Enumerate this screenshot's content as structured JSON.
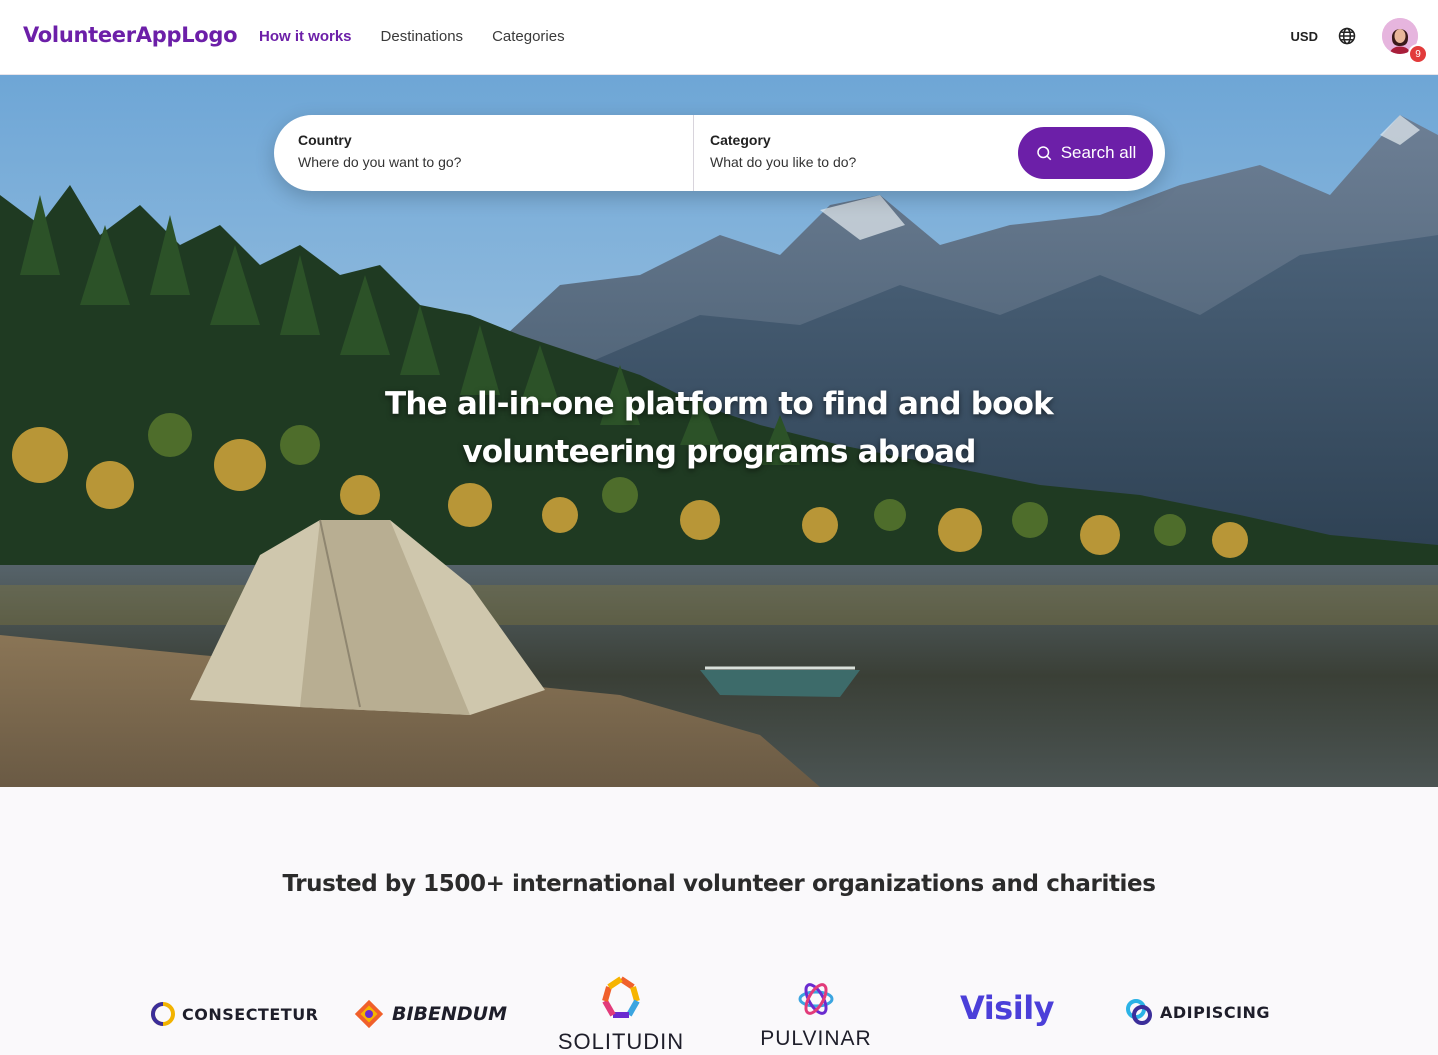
{
  "header": {
    "logo": "VolunteerAppLogo",
    "nav": [
      "How it works",
      "Destinations",
      "Categories"
    ],
    "currency": "USD",
    "notifications": "9"
  },
  "search": {
    "country_label": "Country",
    "country_placeholder": "Where do you want to go?",
    "category_label": "Category",
    "category_placeholder": "What do you like to do?",
    "button_label": "Search all"
  },
  "hero": {
    "headline_line1": "The all-in-one platform to find and book",
    "headline_line2": "volunteering programs abroad"
  },
  "trusted": {
    "heading": "Trusted by 1500+ international volunteer organizations and charities",
    "partners": [
      "CONSECTETUR",
      "BIBENDUM",
      "SOLITUDIN",
      "PULVINAR",
      "Visily",
      "ADIPISCING"
    ]
  },
  "colors": {
    "brand": "#6c1fa8",
    "badge": "#e23b3b"
  }
}
